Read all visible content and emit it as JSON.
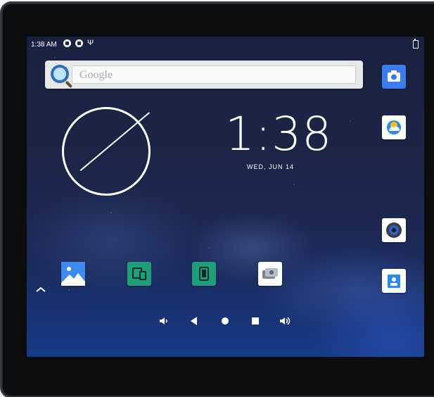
{
  "status_bar": {
    "time": "1:38 AM"
  },
  "search": {
    "placeholder": "Google"
  },
  "clock": {
    "time": "1:38",
    "date": "WED, JUN 14"
  },
  "icons": {
    "camera": "camera-icon",
    "weather": "weather-icon",
    "audio": "audio-icon",
    "contacts": "contacts-icon",
    "gallery": "gallery-icon",
    "device_tools": "device-tools-icon",
    "tablet": "tablet-icon",
    "gear": "gear-app-icon"
  },
  "colors": {
    "camera_bg": "#3d7cf0",
    "tools_bg": "#1f9e7c"
  }
}
